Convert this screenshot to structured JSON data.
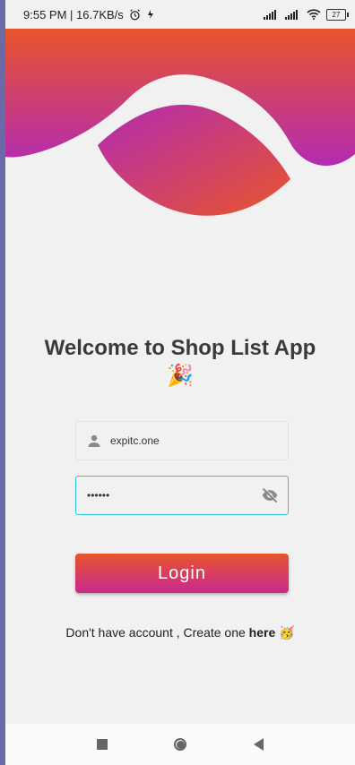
{
  "status": {
    "time_speed": "9:55 PM | 16.7KB/s",
    "battery": "27"
  },
  "app": {
    "welcome_title": "Welcome to Shop List App",
    "party_emoji": "🎉",
    "email_value": "expitc.one",
    "password_value": "••••••",
    "login_label": "Login",
    "signup_prefix": "Don't have account , Create one ",
    "signup_link": "here",
    "signup_emoji": "🥳"
  },
  "colors": {
    "gradient_top": "#e8552b",
    "gradient_bottom": "#c8298f",
    "focus_border": "#2ec3d6"
  },
  "icons": {
    "user": "user-icon",
    "eye": "eye-off-icon",
    "alarm": "alarm-icon",
    "wifi": "wifi-icon"
  }
}
